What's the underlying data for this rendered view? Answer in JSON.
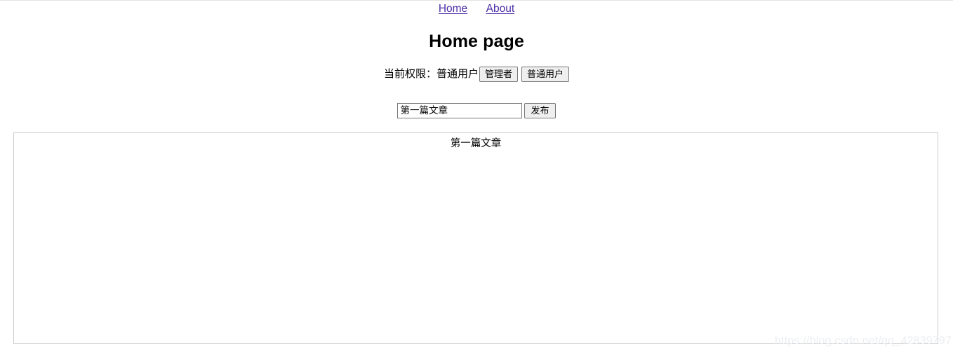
{
  "page": {
    "title": "Home page"
  },
  "nav": {
    "links": [
      {
        "label": "Home",
        "name": "nav-link-home"
      },
      {
        "label": "About",
        "name": "nav-link-about"
      }
    ]
  },
  "permission": {
    "label": "当前权限：普通用户",
    "current_role": "普通用户",
    "buttons": [
      {
        "label": "管理者"
      },
      {
        "label": "普通用户"
      }
    ]
  },
  "publish": {
    "input_value": "第一篇文章",
    "input_placeholder": "",
    "button_label": "发布"
  },
  "article": {
    "title": "第一篇文章",
    "body": ""
  },
  "watermark": {
    "text": "https://blog.csdn.net/qq_42839797"
  },
  "colors": {
    "link": "#4b2ea8",
    "button_face": "#efefef",
    "button_border": "#767676",
    "box_border": "#c8cbcf",
    "watermark": "#eceef0"
  }
}
